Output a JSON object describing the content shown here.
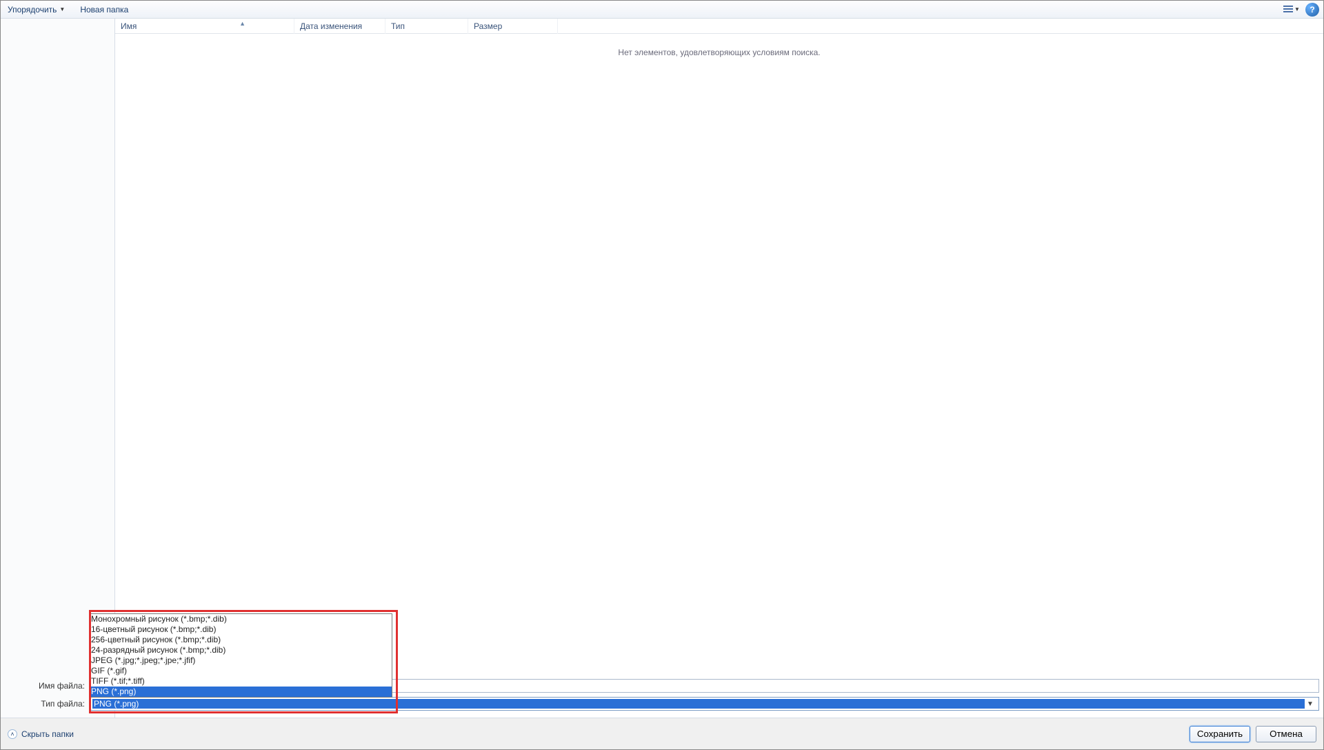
{
  "toolbar": {
    "organize": "Упорядочить",
    "new_folder": "Новая папка"
  },
  "columns": {
    "name": "Имя",
    "date": "Дата изменения",
    "type": "Тип",
    "size": "Размер"
  },
  "list": {
    "empty": "Нет элементов, удовлетворяющих условиям поиска."
  },
  "fields": {
    "filename_label": "Имя файла:",
    "filetype_label": "Тип файла:",
    "filename_value": "",
    "filetype_selected": "PNG (*.png)"
  },
  "filetype_options": [
    {
      "label": "Монохромный рисунок (*.bmp;*.dib)",
      "selected": false
    },
    {
      "label": "16-цветный рисунок (*.bmp;*.dib)",
      "selected": false
    },
    {
      "label": "256-цветный рисунок (*.bmp;*.dib)",
      "selected": false
    },
    {
      "label": "24-разрядный рисунок (*.bmp;*.dib)",
      "selected": false
    },
    {
      "label": "JPEG (*.jpg;*.jpeg;*.jpe;*.jfif)",
      "selected": false
    },
    {
      "label": "GIF (*.gif)",
      "selected": false
    },
    {
      "label": "TIFF (*.tif;*.tiff)",
      "selected": false
    },
    {
      "label": "PNG (*.png)",
      "selected": true
    }
  ],
  "footer": {
    "hide_folders": "Скрыть папки",
    "save": "Сохранить",
    "cancel": "Отмена"
  }
}
